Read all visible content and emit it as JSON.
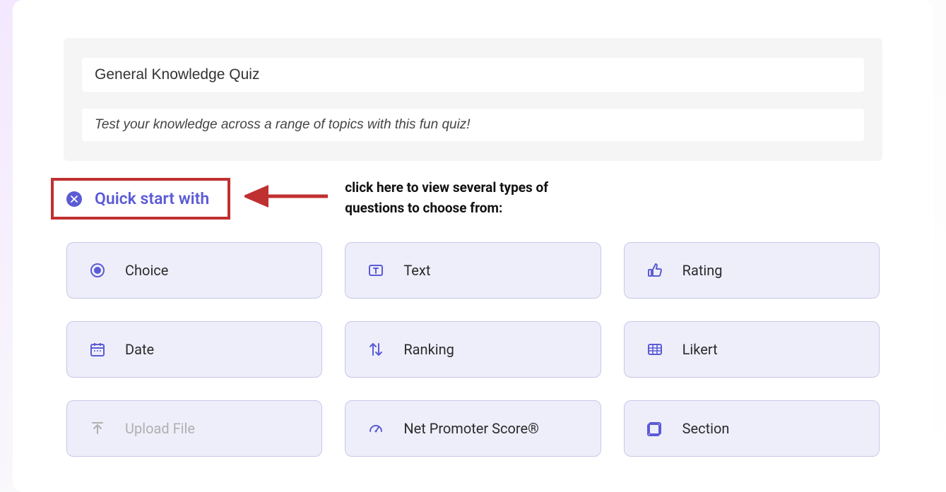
{
  "header": {
    "title": "General Knowledge Quiz",
    "description": "Test your knowledge across a range of topics with this fun quiz!"
  },
  "quickstart": {
    "label": "Quick start with"
  },
  "annotation": {
    "text": "click here to view  several types of questions to choose from:"
  },
  "options": [
    {
      "label": "Choice",
      "icon": "radio",
      "disabled": false
    },
    {
      "label": "Text",
      "icon": "text",
      "disabled": false
    },
    {
      "label": "Rating",
      "icon": "thumbs-up",
      "disabled": false
    },
    {
      "label": "Date",
      "icon": "calendar",
      "disabled": false
    },
    {
      "label": "Ranking",
      "icon": "arrows-up-down",
      "disabled": false
    },
    {
      "label": "Likert",
      "icon": "grid",
      "disabled": false
    },
    {
      "label": "Upload File",
      "icon": "upload",
      "disabled": true
    },
    {
      "label": "Net Promoter Score®",
      "icon": "gauge",
      "disabled": false
    },
    {
      "label": "Section",
      "icon": "section",
      "disabled": false
    }
  ]
}
